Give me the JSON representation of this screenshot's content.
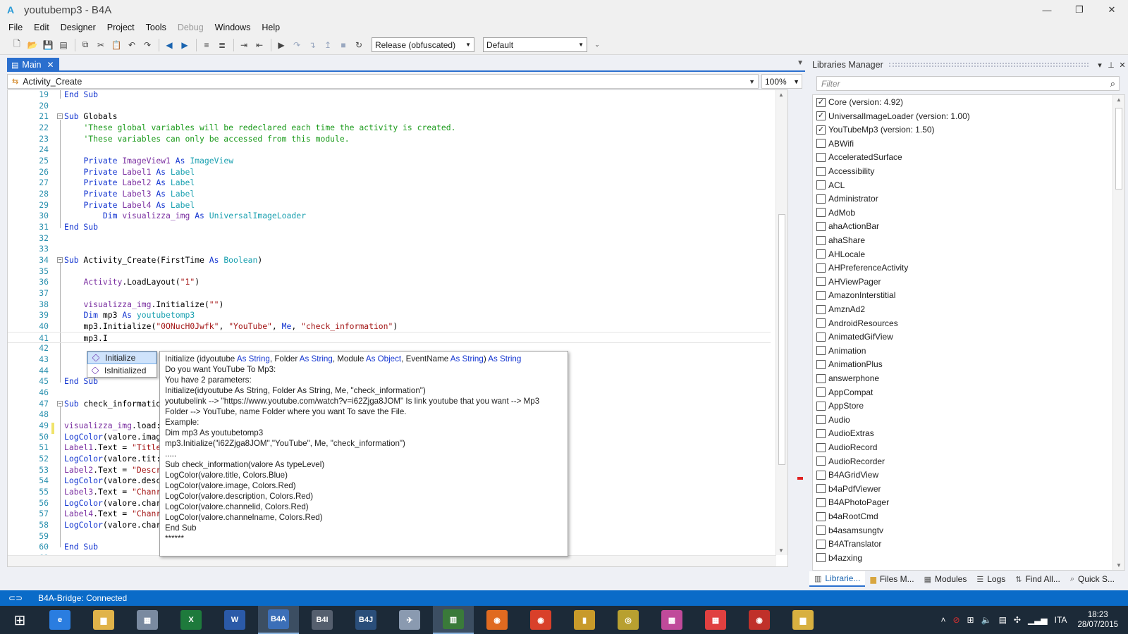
{
  "window": {
    "app_icon": "A",
    "title": "youtubemp3 - B4A"
  },
  "menu": [
    "File",
    "Edit",
    "Designer",
    "Project",
    "Tools",
    "Debug",
    "Windows",
    "Help"
  ],
  "toolbar": {
    "build_config": "Release (obfuscated)",
    "device": "Default"
  },
  "editor": {
    "tab_label": "Main",
    "sub_selector": "Activity_Create",
    "zoom": "100%"
  },
  "autocomplete": {
    "items": [
      "Initialize",
      "IsInitialized"
    ],
    "selected": "Initialize"
  },
  "tooltip": {
    "sig_name": "Initialize (idyoutube ",
    "sig_p1_type": "As String",
    "sig_p2": ", Folder ",
    "sig_p2_type": "As String",
    "sig_p3": ", Module ",
    "sig_p3_type": "As Object",
    "sig_p4": ", EventName ",
    "sig_p4_type": "As String",
    "sig_p5": ") ",
    "sig_ret": "As String",
    "lines": [
      "Do you want YouTube To Mp3:",
      "You have 2 parameters:",
      "Initialize(idyoutube As String, Folder As String, Me, \"check_information\")",
      "youtubelink --> \"https://www.youtube.com/watch?v=i62Zjga8JOM\" Is link youtube that you want --> Mp3",
      "Folder --> YouTube, name Folder where you want To save the File.",
      "Example:",
      "Dim mp3 As youtubetomp3",
      "mp3.Initialize(\"i62Zjga8JOM\",\"YouTube\", Me, \"check_information\")",
      ".....",
      "Sub check_information(valore As typeLevel)",
      "LogColor(valore.title, Colors.Blue)",
      "LogColor(valore.image, Colors.Red)",
      "LogColor(valore.description, Colors.Red)",
      "LogColor(valore.channelid, Colors.Red)",
      "LogColor(valore.channelname, Colors.Red)",
      "End Sub",
      "******"
    ]
  },
  "libraries": {
    "header": "Libraries Manager",
    "filter_placeholder": "Filter",
    "items": [
      {
        "name": "Core (version: 4.92)",
        "checked": true
      },
      {
        "name": "UniversalImageLoader (version: 1.00)",
        "checked": true
      },
      {
        "name": "YouTubeMp3 (version: 1.50)",
        "checked": true
      },
      {
        "name": "ABWifi",
        "checked": false
      },
      {
        "name": "AcceleratedSurface",
        "checked": false
      },
      {
        "name": "Accessibility",
        "checked": false
      },
      {
        "name": "ACL",
        "checked": false
      },
      {
        "name": "Administrator",
        "checked": false
      },
      {
        "name": "AdMob",
        "checked": false
      },
      {
        "name": "ahaActionBar",
        "checked": false
      },
      {
        "name": "ahaShare",
        "checked": false
      },
      {
        "name": "AHLocale",
        "checked": false
      },
      {
        "name": "AHPreferenceActivity",
        "checked": false
      },
      {
        "name": "AHViewPager",
        "checked": false
      },
      {
        "name": "AmazonInterstitial",
        "checked": false
      },
      {
        "name": "AmznAd2",
        "checked": false
      },
      {
        "name": "AndroidResources",
        "checked": false
      },
      {
        "name": "AnimatedGifView",
        "checked": false
      },
      {
        "name": "Animation",
        "checked": false
      },
      {
        "name": "AnimationPlus",
        "checked": false
      },
      {
        "name": "answerphone",
        "checked": false
      },
      {
        "name": "AppCompat",
        "checked": false
      },
      {
        "name": "AppStore",
        "checked": false
      },
      {
        "name": "Audio",
        "checked": false
      },
      {
        "name": "AudioExtras",
        "checked": false
      },
      {
        "name": "AudioRecord",
        "checked": false
      },
      {
        "name": "AudioRecorder",
        "checked": false
      },
      {
        "name": "B4AGridView",
        "checked": false
      },
      {
        "name": "b4aPdfViewer",
        "checked": false
      },
      {
        "name": "B4APhotoPager",
        "checked": false
      },
      {
        "name": "b4aRootCmd",
        "checked": false
      },
      {
        "name": "b4asamsungtv",
        "checked": false
      },
      {
        "name": "B4ATranslator",
        "checked": false
      },
      {
        "name": "b4azxing",
        "checked": false
      }
    ]
  },
  "panel_tabs": [
    "Librarie...",
    "Files M...",
    "Modules",
    "Logs",
    "Find All...",
    "Quick S..."
  ],
  "status": {
    "text": "B4A-Bridge: Connected"
  },
  "taskbar": {
    "apps": [
      "IE",
      "Explorer",
      "Calc",
      "Excel",
      "Word",
      "B4A",
      "B4i",
      "B4J",
      "Plane",
      "Chart",
      "Firefox",
      "Chrome",
      "DB",
      "Coins",
      "Palette",
      "Apps",
      "Chrome2",
      "Folder"
    ],
    "lang": "ITA",
    "time": "18:23",
    "date": "28/07/2015"
  },
  "colors": {
    "accent": "#2a6fce",
    "statusbar": "#0a6bc8",
    "keyword": "#1234d0",
    "comment": "#1a9a1a",
    "string": "#a31515"
  }
}
